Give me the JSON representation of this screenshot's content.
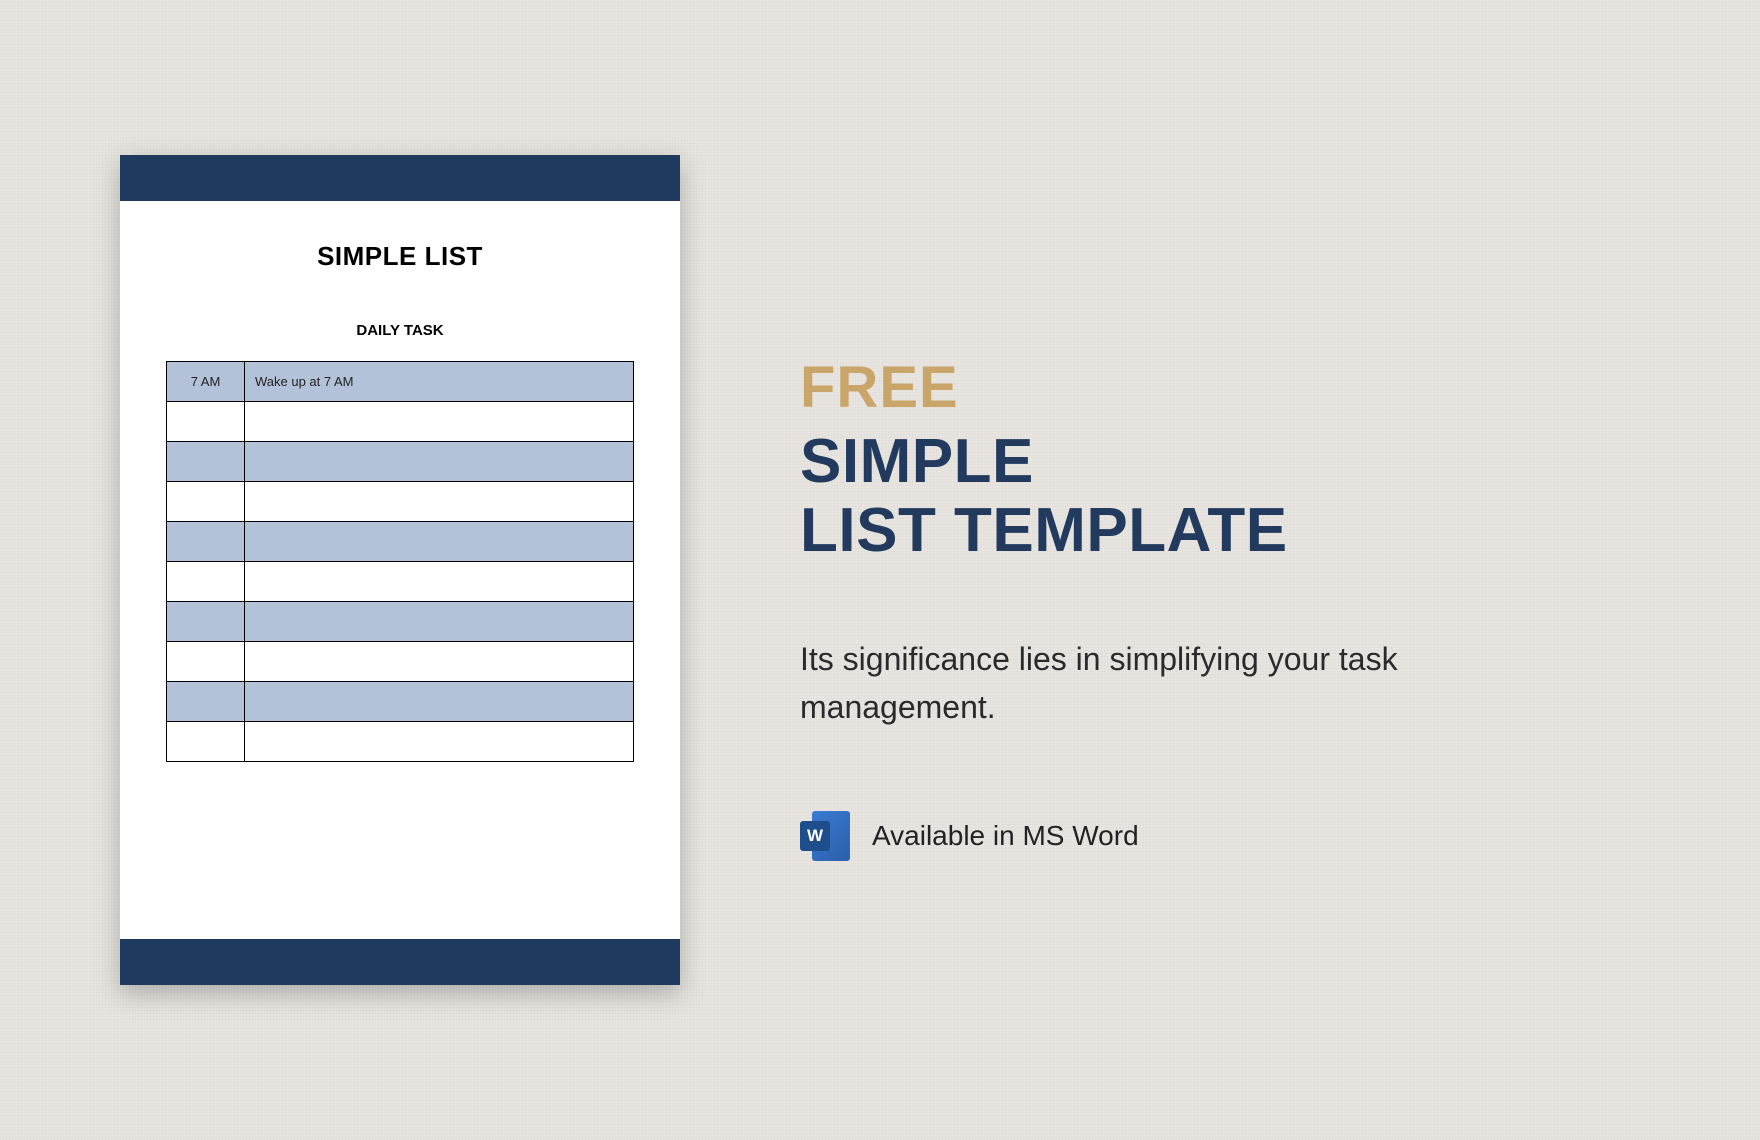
{
  "document": {
    "title": "SIMPLE LIST",
    "subtitle": "DAILY TASK",
    "rows": [
      {
        "time": "7 AM",
        "task": "Wake up  at 7 AM",
        "shaded": true
      },
      {
        "time": "",
        "task": "",
        "shaded": false
      },
      {
        "time": "",
        "task": "",
        "shaded": true
      },
      {
        "time": "",
        "task": "",
        "shaded": false
      },
      {
        "time": "",
        "task": "",
        "shaded": true
      },
      {
        "time": "",
        "task": "",
        "shaded": false
      },
      {
        "time": "",
        "task": "",
        "shaded": true
      },
      {
        "time": "",
        "task": "",
        "shaded": false
      },
      {
        "time": "",
        "task": "",
        "shaded": true
      },
      {
        "time": "",
        "task": "",
        "shaded": false
      }
    ]
  },
  "info": {
    "badge": "FREE",
    "heading_line1": "SIMPLE",
    "heading_line2": "LIST TEMPLATE",
    "description": "Its significance lies in simplifying your task management.",
    "format_label": "Available in MS Word",
    "word_icon_letter": "W"
  },
  "colors": {
    "navy": "#1f3a5f",
    "gold": "#c9a56a",
    "row_shade": "#b3c2d9"
  }
}
